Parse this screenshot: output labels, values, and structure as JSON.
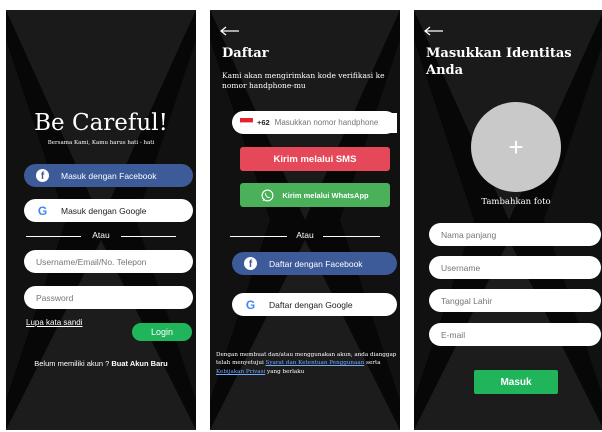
{
  "colors": {
    "facebook": "#3d5a99",
    "sms": "#e54858",
    "whatsapp": "#4ab05a",
    "login": "#20b55a",
    "screen_bg": "#070707",
    "photo_circle": "#c9c9c9"
  },
  "login_screen": {
    "brand": "Be Careful!",
    "tagline": "Bersama Kami, Kamu harus hati - hati",
    "facebook_label": "Masuk dengan Facebook",
    "google_label": "Masuk dengan Google",
    "divider_text": "Atau",
    "username_placeholder": "Username/Email/No. Telepon",
    "password_placeholder": "Password",
    "forgot_password": "Lupa kata sandi",
    "login_button": "Login",
    "no_account_text": "Belum memiliki akun ?",
    "create_account_link": "Buat Akun Baru"
  },
  "register_screen": {
    "back_icon": "arrow-left-icon",
    "title": "Daftar",
    "subtitle": "Kami akan mengirimkan kode verifikasi ke nomor handphone-mu",
    "country_code": "+62",
    "phone_placeholder": "Masukkan nomor handphone",
    "sms_button": "Kirim melalui SMS",
    "whatsapp_button": "Kirim melalui WhatsApp",
    "divider_text": "Atau",
    "facebook_label": "Daftar dengan Facebook",
    "google_label": "Daftar dengan Google",
    "terms_part1": "Dengan membuat dan/atau menggunakan akun, anda dianggap telah menyetujui ",
    "terms_link1": "Syarat dan Ketentuan Penggunaan",
    "terms_part2": " serta ",
    "terms_link2": "Kebijakan Privasi",
    "terms_part3": " yang berlaku"
  },
  "identity_screen": {
    "back_icon": "arrow-left-icon",
    "title": "Masukkan Identitas Anda",
    "add_photo_icon": "plus-icon",
    "add_photo_label": "Tambahkan foto",
    "full_name_placeholder": "Nama panjang",
    "username_placeholder": "Username",
    "birthdate_placeholder": "Tanggal Lahir",
    "email_placeholder": "E-mail",
    "submit_button": "Masuk"
  }
}
